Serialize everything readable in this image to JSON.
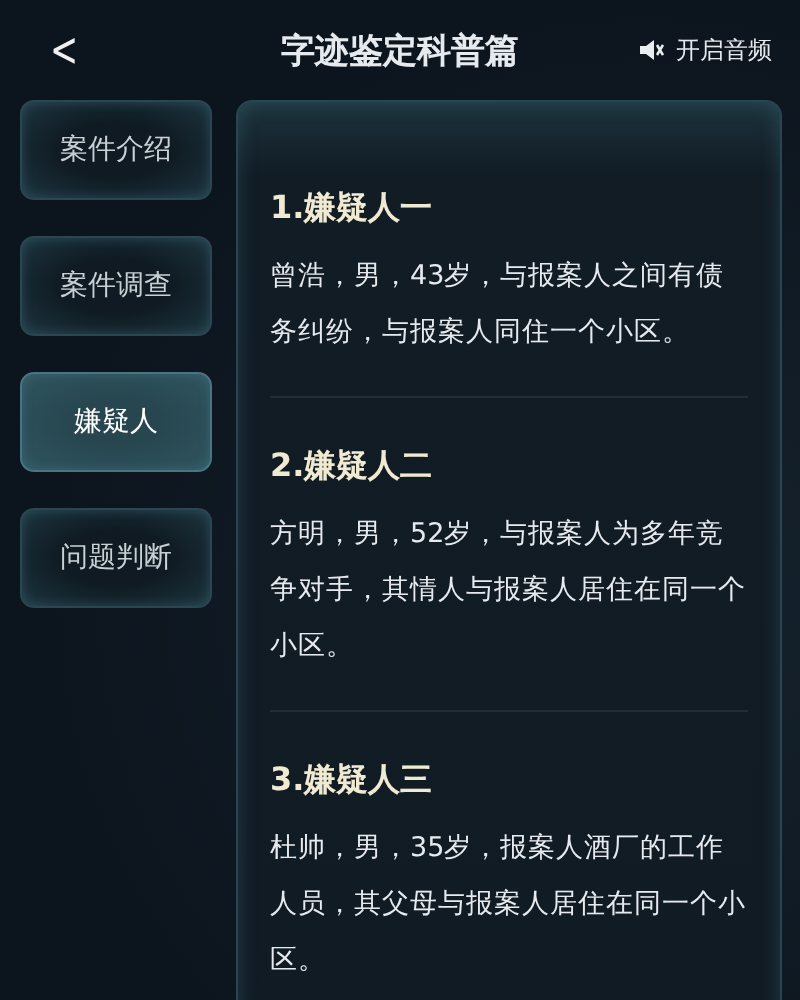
{
  "header": {
    "back": "<",
    "title": "字迹鉴定科普篇",
    "audio_label": "开启音频"
  },
  "sidebar": {
    "items": [
      {
        "label": "案件介绍",
        "selected": false
      },
      {
        "label": "案件调查",
        "selected": false
      },
      {
        "label": "嫌疑人",
        "selected": true
      },
      {
        "label": "问题判断",
        "selected": false
      }
    ]
  },
  "sections": [
    {
      "heading": "1.嫌疑人一",
      "body": "曾浩，男，43岁，与报案人之间有债务纠纷，与报案人同住一个小区。"
    },
    {
      "heading": "2.嫌疑人二",
      "body": "方明，男，52岁，与报案人为多年竞争对手，其情人与报案人居住在同一个小区。"
    },
    {
      "heading": "3.嫌疑人三",
      "body": "杜帅，男，35岁，报案人酒厂的工作人员，其父母与报案人居住在同一个小区。"
    }
  ]
}
